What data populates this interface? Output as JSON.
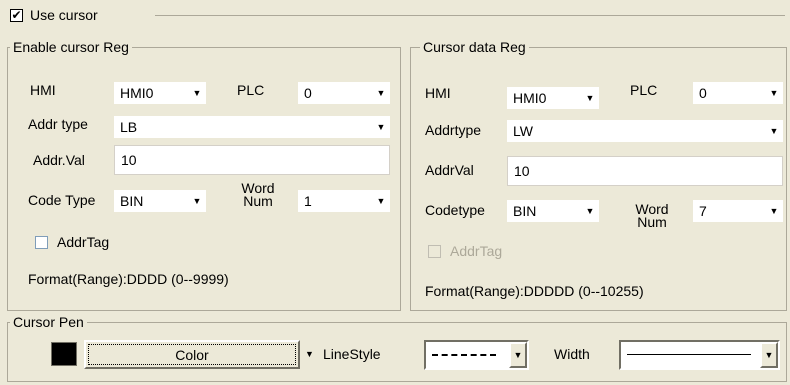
{
  "use_cursor": {
    "checked": true,
    "label": "Use cursor",
    "checkmark": "✔"
  },
  "enable_reg": {
    "title": "Enable cursor Reg",
    "hmi_label": "HMI",
    "hmi_value": "HMI0",
    "plc_label": "PLC",
    "plc_value": "0",
    "addrtype_label": "Addr type",
    "addrtype_value": "LB",
    "addrval_label": "Addr.Val",
    "addrval_value": "10",
    "codetype_label": "Code Type",
    "codetype_value": "BIN",
    "wordnum_label_1": "Word",
    "wordnum_label_2": "Num",
    "wordnum_value": "1",
    "addrtag_label": "AddrTag",
    "addrtag_checked": false,
    "format_text": "Format(Range):DDDD (0--9999)"
  },
  "data_reg": {
    "title": "Cursor data Reg",
    "hmi_label": "HMI",
    "hmi_value": "HMI0",
    "plc_label": "PLC",
    "plc_value": "0",
    "addrtype_label": "Addrtype",
    "addrtype_value": "LW",
    "addrval_label": "AddrVal",
    "addrval_value": "10",
    "codetype_label": "Codetype",
    "codetype_value": "BIN",
    "wordnum_label_1": "Word",
    "wordnum_label_2": "Num",
    "wordnum_value": "7",
    "addrtag_label": "AddrTag",
    "addrtag_checked": false,
    "addrtag_disabled": true,
    "format_text": "Format(Range):DDDDD (0--10255)"
  },
  "cursor_pen": {
    "title": "Cursor Pen",
    "color_swatch": "#000000",
    "color_button_label": "Color",
    "linestyle_label": "LineStyle",
    "width_label": "Width"
  },
  "icons": {
    "dropdown": "triangle-down"
  }
}
